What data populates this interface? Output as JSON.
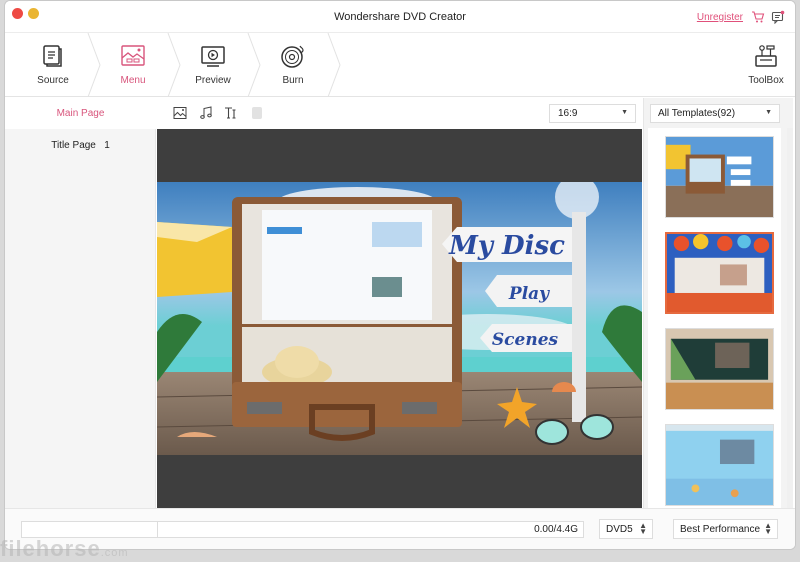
{
  "window": {
    "title": "Wondershare DVD Creator",
    "unregister_label": "Unregister",
    "icons": [
      "cart-icon",
      "feedback-icon"
    ]
  },
  "steps": [
    {
      "label": "Source",
      "icon": "source-icon",
      "active": false
    },
    {
      "label": "Menu",
      "icon": "menu-image-icon",
      "active": true
    },
    {
      "label": "Preview",
      "icon": "preview-play-icon",
      "active": false
    },
    {
      "label": "Burn",
      "icon": "burn-disc-icon",
      "active": false
    }
  ],
  "toolbox_label": "ToolBox",
  "left_panel": {
    "main_page_label": "Main Page",
    "title_page_label": "Title Page",
    "title_page_count": "1"
  },
  "editor_toolbar": {
    "tools": [
      "background-image-icon",
      "music-icon",
      "text-icon",
      "chapter-icon"
    ],
    "aspect_ratio": "16:9"
  },
  "menu_preview": {
    "title": "My Disc",
    "buttons": [
      "Play",
      "Scenes"
    ]
  },
  "template_panel": {
    "filter_label": "All Templates(92)",
    "templates": [
      {
        "name": "beach-suitcase",
        "selected": false
      },
      {
        "name": "balloons-party",
        "selected": true
      },
      {
        "name": "classroom-chalkboard",
        "selected": false
      },
      {
        "name": "underwater-blue",
        "selected": false
      }
    ]
  },
  "bottom_bar": {
    "capacity_text": "0.00/4.4G",
    "disc_type": "DVD5",
    "quality": "Best Performance"
  },
  "colors": {
    "accent": "#d8557c",
    "selected_template_border": "#e66a3f",
    "canvas_bg": "#3e3e3e"
  },
  "watermark": {
    "text": "filehorse",
    "suffix": ".com"
  }
}
